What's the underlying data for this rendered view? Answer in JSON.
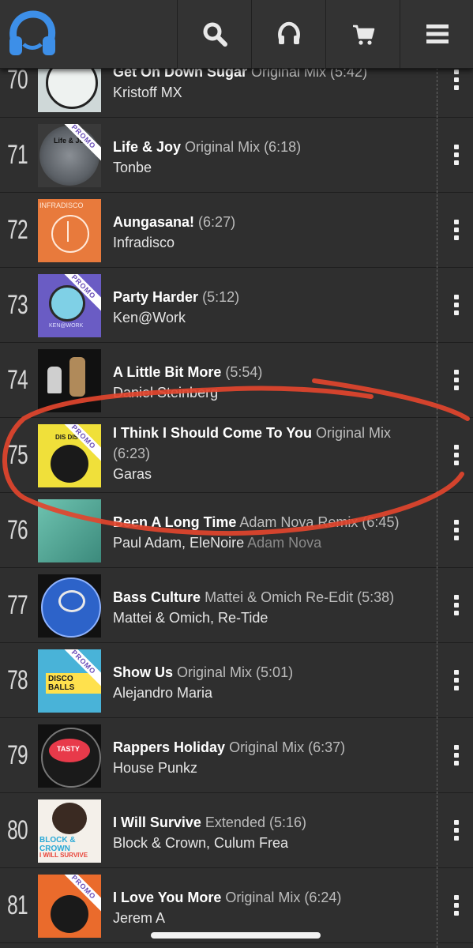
{
  "colors": {
    "logo_blue": "#3d8fe8",
    "annotation_red": "#e2452e",
    "promo_text": "#6b4fb8"
  },
  "nav": {
    "logo": "headphones-logo-icon",
    "buttons": [
      {
        "icon": "search-icon"
      },
      {
        "icon": "headphones-icon"
      },
      {
        "icon": "cart-icon"
      },
      {
        "icon": "menu-icon"
      }
    ]
  },
  "tracks": [
    {
      "rank": "70",
      "title": "Get On Down Sugar",
      "mix": "Original Mix (5:42)",
      "artist": "Kristoff MX",
      "artist_extra": "",
      "promo": false
    },
    {
      "rank": "71",
      "title": "Life & Joy",
      "mix": "Original Mix (6:18)",
      "artist": "Tonbe",
      "artist_extra": "",
      "promo": true
    },
    {
      "rank": "72",
      "title": "Aungasana!",
      "mix": "(6:27)",
      "artist": "Infradisco",
      "artist_extra": "",
      "promo": false
    },
    {
      "rank": "73",
      "title": "Party Harder",
      "mix": "(5:12)",
      "artist": "Ken@Work",
      "artist_extra": "",
      "promo": true
    },
    {
      "rank": "74",
      "title": "A Little Bit More",
      "mix": "(5:54)",
      "artist": "Daniel Steinberg",
      "artist_extra": "",
      "promo": false
    },
    {
      "rank": "75",
      "title": "I Think I Should Come To You",
      "mix": "Original Mix",
      "mix2": "(6:23)",
      "artist": "Garas",
      "artist_extra": "",
      "promo": true
    },
    {
      "rank": "76",
      "title": "Been A Long Time",
      "mix": "Adam Nova Remix (6:45)",
      "artist": "Paul Adam, EleNoire",
      "artist_extra": "Adam Nova",
      "promo": false
    },
    {
      "rank": "77",
      "title": "Bass Culture",
      "mix": "Mattei & Omich Re-Edit (5:38)",
      "artist": "Mattei & Omich, Re-Tide",
      "artist_extra": "",
      "promo": false
    },
    {
      "rank": "78",
      "title": "Show Us",
      "mix": "Original Mix (5:01)",
      "artist": "Alejandro Maria",
      "artist_extra": "",
      "promo": true
    },
    {
      "rank": "79",
      "title": "Rappers Holiday",
      "mix": "Original Mix (6:37)",
      "artist": "House Punkz",
      "artist_extra": "",
      "promo": false
    },
    {
      "rank": "80",
      "title": "I Will Survive",
      "mix": "Extended (5:16)",
      "artist": "Block & Crown, Culum Frea",
      "artist_extra": "",
      "promo": false
    },
    {
      "rank": "81",
      "title": "I Love You More",
      "mix": "Original Mix (6:24)",
      "artist": "Jerem A",
      "artist_extra": "",
      "promo": true
    }
  ],
  "promo_label": "PROMO",
  "art_text": {
    "row70": "",
    "row71": "Life & Joy",
    "row72": "INFRADISCO",
    "row73": "KEN@WORK",
    "row75": "DIS DISCO",
    "row77": "",
    "row78": "DISCO BALLS",
    "row79": "TASTY",
    "row80": "BLOCK & CROWN",
    "row80b": "I WILL SURVIVE"
  }
}
